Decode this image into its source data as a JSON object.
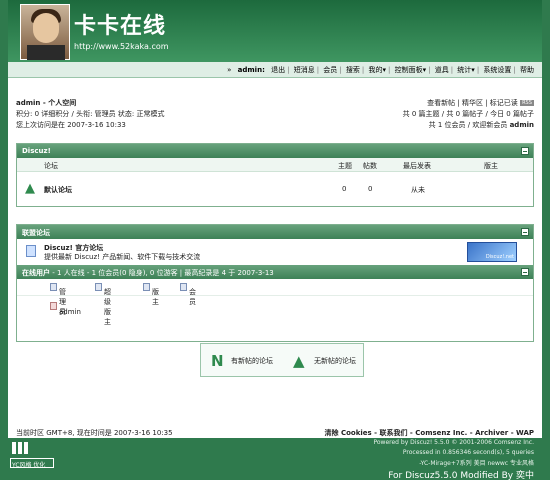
{
  "header": {
    "title": "卡卡在线",
    "url": "http://www.52kaka.com"
  },
  "nav": {
    "user_prefix": "»",
    "user": "admin:",
    "items": [
      "退出",
      "短消息",
      "会员",
      "搜索",
      "我的▾",
      "控制面板▾",
      "道具",
      "统计▾",
      "系统设置",
      "帮助"
    ]
  },
  "userinfo": {
    "line1_name": "admin",
    "line1_rest": " - 个人空间",
    "line2": "积分: 0 详细积分 / 头衔: 管理员 状态: 正常模式",
    "line3": "您上次访问是在 2007-3-16 10:33"
  },
  "topright": {
    "links": "查看新帖 | 精华区 | 标记已读",
    "rss": "RSS",
    "stats1": "共 0 篇主题 / 共 0 篇帖子 / 今日 0 篇帖子",
    "stats2": "共 1 位会员 / 欢迎新会员 ",
    "newmember": "admin"
  },
  "forums": {
    "category": "Discuz!",
    "headers": {
      "forum": "论坛",
      "threads": "主题",
      "posts": "帖数",
      "last": "最后发表",
      "moderator": "版主"
    },
    "rows": [
      {
        "name": "默认论坛",
        "threads": "0",
        "posts": "0",
        "last": "从未",
        "moderator": ""
      }
    ]
  },
  "links": {
    "title": "联盟论坛",
    "items": [
      {
        "name": "Discuz! 官方论坛",
        "desc": "提供最新 Discuz! 产品新闻、软件下载与技术交流",
        "banner": "Discuz!.net"
      }
    ]
  },
  "online": {
    "label": "在线用户",
    "summary": " - 1 人在线 - 1 位会员(0 隐身), 0 位游客 | 最高纪录是 4 于 2007-3-13",
    "legend": [
      "管理员",
      "超级版主",
      "版主",
      "会员"
    ],
    "members": [
      "admin"
    ]
  },
  "legend_box": {
    "new": "有新帖的论坛",
    "nonew": "无新帖的论坛"
  },
  "footer_line": {
    "left": "当前时区 GMT+8, 现在时间是 2007-3-16 10:35",
    "right": "清除 Cookies - 联系我们 - Comsenz Inc. - Archiver - WAP"
  },
  "footer": {
    "l1": "Powered by Discuz! 5.5.0 © 2001-2006 Comsenz Inc.",
    "l2": "Processed in 0.856346 second(s), 5 queries",
    "l3": "-YC-Mirage+7系列 美目 newwc 专业风格",
    "l4": "For Discuz5.5.0 Modified By 奕中",
    "badge": "YC风格 优化"
  }
}
